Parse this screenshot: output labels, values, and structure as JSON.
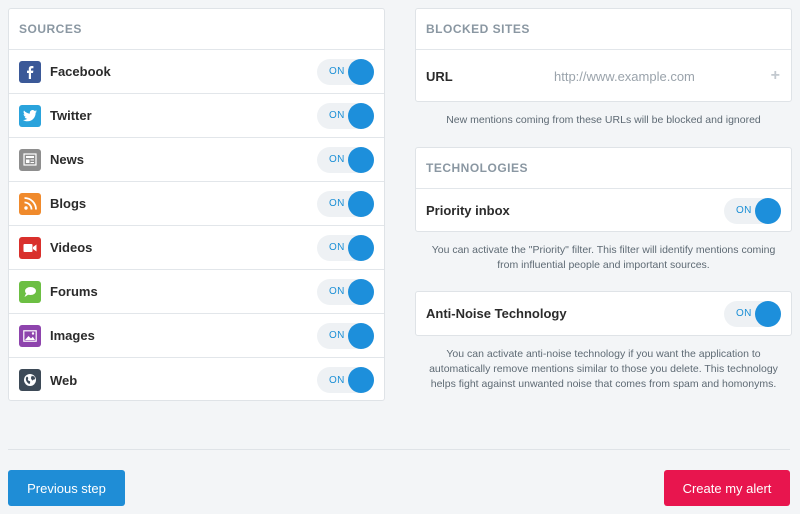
{
  "sources": {
    "header": "SOURCES",
    "items": [
      {
        "id": "facebook",
        "label": "Facebook",
        "toggle": "ON",
        "icon": "facebook-icon",
        "color": "#3b5998"
      },
      {
        "id": "twitter",
        "label": "Twitter",
        "toggle": "ON",
        "icon": "twitter-icon",
        "color": "#2aa3dc"
      },
      {
        "id": "news",
        "label": "News",
        "toggle": "ON",
        "icon": "news-icon",
        "color": "#8e8e8e"
      },
      {
        "id": "blogs",
        "label": "Blogs",
        "toggle": "ON",
        "icon": "rss-icon",
        "color": "#f08a2c"
      },
      {
        "id": "videos",
        "label": "Videos",
        "toggle": "ON",
        "icon": "video-icon",
        "color": "#d9302c"
      },
      {
        "id": "forums",
        "label": "Forums",
        "toggle": "ON",
        "icon": "forum-icon",
        "color": "#6cbf43"
      },
      {
        "id": "images",
        "label": "Images",
        "toggle": "ON",
        "icon": "image-icon",
        "color": "#8e44ad"
      },
      {
        "id": "web",
        "label": "Web",
        "toggle": "ON",
        "icon": "globe-icon",
        "color": "#3d4a57"
      }
    ]
  },
  "blocked": {
    "header": "BLOCKED SITES",
    "url_label": "URL",
    "url_placeholder": "http://www.example.com",
    "add_icon": "+",
    "note": "New mentions coming from these URLs will be blocked and ignored"
  },
  "technologies": {
    "header": "TECHNOLOGIES",
    "priority_label": "Priority inbox",
    "priority_toggle": "ON",
    "priority_note": "You can activate the \"Priority\" filter. This filter will identify mentions coming from influential people and important sources.",
    "antinoise_label": "Anti-Noise Technology",
    "antinoise_toggle": "ON",
    "antinoise_note": "You can activate anti-noise technology if you want the application to automatically remove mentions similar to those you delete. This technology helps fight against unwanted noise that comes from spam and homonyms."
  },
  "footer": {
    "prev_label": "Previous step",
    "create_label": "Create my alert"
  },
  "colors": {
    "accent": "#1d8fdb",
    "primary_button": "#1f8dd6",
    "cta_button": "#e8154e"
  }
}
